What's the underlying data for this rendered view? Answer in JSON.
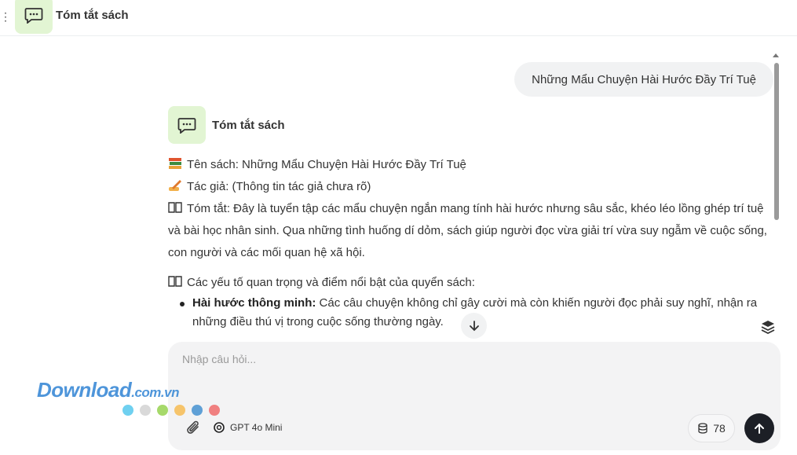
{
  "header": {
    "menu_glyph": "⋮",
    "title": "Tóm tắt sách"
  },
  "user_message": "Những Mẩu Chuyện Hài Hước Đầy Trí Tuệ",
  "assistant": {
    "name": "Tóm tắt sách",
    "book_title_line": "Tên sách: Những Mẩu Chuyện Hài Hước Đầy Trí Tuệ",
    "author_line": "Tác giả: (Thông tin tác giả chưa rõ)",
    "summary_line": "Tóm tắt: Đây là tuyển tập các mẩu chuyện ngắn mang tính hài hước nhưng sâu sắc, khéo léo lồng ghép trí tuệ và bài học nhân sinh. Qua những tình huống dí dỏm, sách giúp người đọc vừa giải trí vừa suy ngẫm về cuộc sống, con người và các mối quan hệ xã hội.",
    "highlights_heading": "Các yếu tố quan trọng và điểm nổi bật của quyển sách:",
    "bullets": [
      {
        "title": "Hài hước thông minh:",
        "text": " Các câu chuyện không chỉ gây cười mà còn khiến người đọc phải suy nghĩ, nhận ra những điều thú vị trong cuộc sống thường ngày."
      }
    ]
  },
  "composer": {
    "placeholder": "Nhập câu hỏi...",
    "model_label": "GPT 4o Mini",
    "credits": "78"
  },
  "watermark": {
    "main": "Download",
    "suffix": ".com.vn",
    "dot_colors": [
      "#6fd0f0",
      "#d9d9d9",
      "#a6d96a",
      "#f6c46b",
      "#5fa0d6",
      "#f08080"
    ]
  },
  "colors": {
    "avatar_bg": "#e2f5d3",
    "send_bg": "#1c1f26",
    "bubble_bg": "#f1f2f3"
  }
}
